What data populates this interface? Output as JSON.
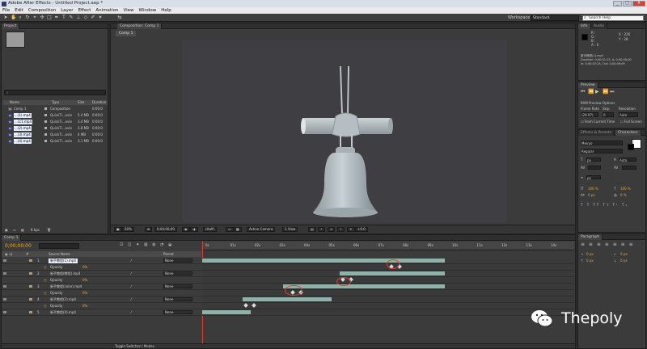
{
  "window": {
    "title": "Adobe After Effects - Untitled Project.aep *",
    "controls": [
      "_",
      "□",
      "X"
    ]
  },
  "menu": [
    "File",
    "Edit",
    "Composition",
    "Layer",
    "Effect",
    "Animation",
    "View",
    "Window",
    "Help"
  ],
  "toolbar": {
    "workspace_label": "Workspace:",
    "workspace_value": "Standard",
    "search_placeholder": "Search Help"
  },
  "project": {
    "tab": "Project",
    "columns": [
      "Name",
      "Type",
      "Size",
      "Duration"
    ],
    "items": [
      {
        "name": "Comp 1",
        "type": "Composition",
        "size": "",
        "duration": "0:00:0",
        "color": "#b6b6b6"
      },
      {
        "name": "...(1).mp4",
        "type": "QuickTi...ovie",
        "size": "5.4 MB",
        "duration": "0:00:0",
        "color": "#b0b0b0"
      },
      {
        "name": "...cc1.mp4",
        "type": "QuickTi...ovie",
        "size": "3.4 MB",
        "duration": "0:00:0",
        "color": "#b0b0b0"
      },
      {
        "name": "...(2).mp4",
        "type": "QuickTi...ovie",
        "size": "3.8 MB",
        "duration": "0:00:0",
        "color": "#b0b0b0"
      },
      {
        "name": "...(3).mp4",
        "type": "QuickTi...ovie",
        "size": "4 MB",
        "duration": "0:00:0",
        "color": "#b0b0b0"
      },
      {
        "name": "...(4).mp4",
        "type": "QuickTi...ovie",
        "size": "3.1 MB",
        "duration": "0:00:0",
        "color": "#b0b0b0"
      }
    ]
  },
  "composition": {
    "tab": "Composition: Comp 1",
    "subtab": "Comp 1",
    "controls": {
      "zoom": "50%",
      "timecode": "0;00;00;00",
      "resolution": "(Half)",
      "camera": "Active Camera",
      "views": "1 View",
      "offset": "+0.0"
    }
  },
  "info": {
    "tab": "Info",
    "audio_tab": "Audio",
    "R": "R :",
    "G": "G :",
    "B": "B :",
    "A": "A : 0",
    "X": "X : 226",
    "Y": "Y : 28",
    "line1": "新手教程(1).mp4",
    "line2": "Duration: 0;00;01;15, Δ: 0;00;00;00",
    "line3": "In: 0;00;07;25, Out: 0;00;09;09"
  },
  "preview": {
    "tab": "Preview",
    "ram_options": "RAM Preview Options",
    "frame_rate_label": "Frame Rate",
    "skip_label": "Skip",
    "resolution_label": "Resolution",
    "frame_rate": "(29.97)",
    "skip": "0",
    "resolution": "Auto",
    "from_current": "From Current Time",
    "full_screen": "Full Screen"
  },
  "characters": {
    "tab": "Characters",
    "effects_tab": "Effects & Presets",
    "font": "Meiryo",
    "style": "Regular",
    "size_unit": "px",
    "tracking": "Auto",
    "scale_v": "100 %",
    "scale_h": "100 %",
    "baseline": "0 px",
    "tsume": "0 %"
  },
  "paragraph": {
    "tab": "Paragraph",
    "indent_left": "0 px",
    "indent_right": "0 px",
    "space_before": "0 px",
    "space_after": "0 px"
  },
  "timeline": {
    "tab": "Comp 1",
    "timecode": "0;00;00;00",
    "columns": [
      "#",
      "Source Name",
      "Parent"
    ],
    "ruler": [
      "0s",
      "01s",
      "02s",
      "03s",
      "04s",
      "05s",
      "06s",
      "07s",
      "08s",
      "09s",
      "10s",
      "11s",
      "12s",
      "13s",
      "14s"
    ],
    "layers": [
      {
        "num": "1",
        "name": "新手教程(1).mp4",
        "sub": "Opacity",
        "mode": "None",
        "selected": true
      },
      {
        "num": "2",
        "name": "新手教程(教程).mp4",
        "sub": "Opacity",
        "mode": "None",
        "selected": false
      },
      {
        "num": "3",
        "name": "新手教程(color).mp4",
        "sub": "Opacity",
        "mode": "None",
        "selected": false
      },
      {
        "num": "4",
        "name": "新手教程(2).mp4",
        "sub": "Opacity",
        "mode": "None",
        "selected": false
      },
      {
        "num": "5",
        "name": "新手教程(4).mp4",
        "sub": "",
        "mode": "None",
        "selected": false
      }
    ],
    "footer": "Toggle Switches / Modes"
  },
  "watermark": {
    "text": "Thepoly"
  }
}
